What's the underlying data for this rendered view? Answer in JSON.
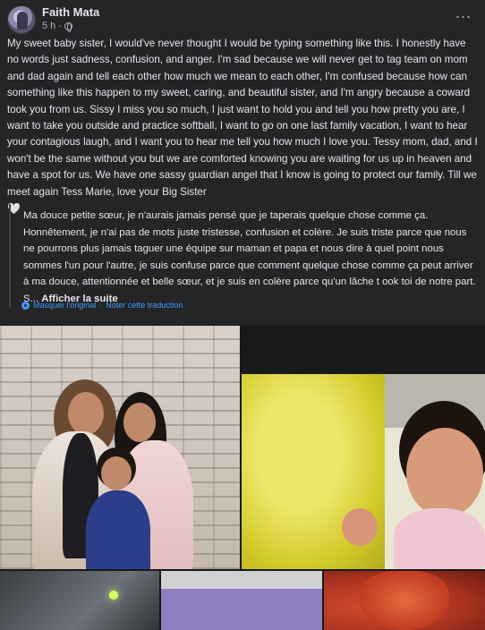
{
  "post": {
    "author": "Faith Mata",
    "time": "5 h",
    "privacy_icon": "globe-icon",
    "more_icon": "more-options-icon",
    "body": "My sweet baby sister, I would've never thought I would be typing something like this. I honestly have no words just sadness, confusion, and anger. I'm sad because we will never get to tag team on mom and dad again and tell each other how much we mean to each other, I'm confused because how can something like this happen to my sweet, caring, and beautiful sister, and I'm angry because a coward took you from us. Sissy I miss you so much, I just want to hold you and tell you how pretty you are, I want to take you outside and practice softball, I want to go on one last family vacation, I want to hear your contagious laugh, and I want you to hear me tell you how much I love you. Tessy mom, dad, and I won't be the same without you but we are comforted knowing you are waiting for us up in heaven and have a spot for us. We have one sassy guardian angel that I know is going to protect our family. Till we meet again Tess Marie, love your Big Sister",
    "body_emoji": "🤍"
  },
  "translation": {
    "text": "Ma douce petite sœur, je n'aurais jamais pensé que je taperais quelque chose comme ça. Honnêtement, je n'ai pas de mots juste tristesse, confusion et colère. Je suis triste parce que nous ne pourrons plus jamais taguer une équipe sur maman et papa et nous dire à quel point nous sommes l'un pour l'autre, je suis confuse parce que comment quelque chose comme ça peut arriver à ma douce, attentionnée et belle sœur, et je suis en colère parce qu'un lâche t ook toi de notre part. S...",
    "see_more": "Afficher la suite",
    "hide_original": "Masquer l'original",
    "separator": "·",
    "rate": "Noter cette traduction",
    "icon": "gear-icon"
  },
  "photos": {
    "count_visible": 5
  },
  "colors": {
    "background": "#242526",
    "text": "#e4e6eb",
    "secondary": "#b0b3b8",
    "link": "#4599ff"
  }
}
